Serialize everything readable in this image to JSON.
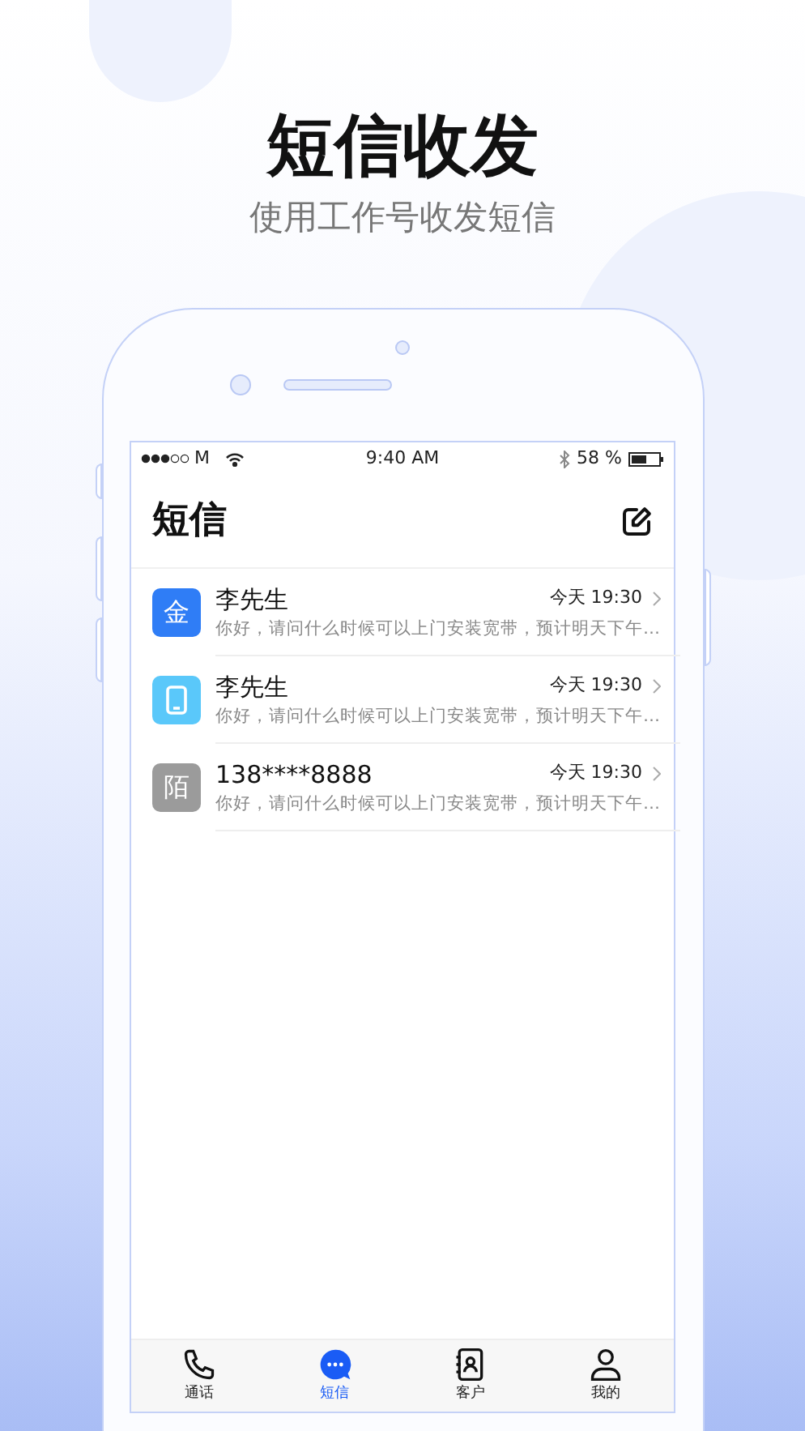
{
  "headline": {
    "title": "短信收发",
    "subtitle": "使用工作号收发短信"
  },
  "status_bar": {
    "carrier": "M",
    "time": "9:40 AM",
    "battery": "58 %"
  },
  "screen_title": "短信",
  "messages": [
    {
      "avatar": {
        "kind": "text",
        "text": "金",
        "color": "#2f7df6"
      },
      "name": "李先生",
      "time": "今天 19:30",
      "preview": "你好，请问什么时候可以上门安装宽带，预计明天下午…"
    },
    {
      "avatar": {
        "kind": "phone",
        "color": "#5ac8fa"
      },
      "name": "李先生",
      "time": "今天 19:30",
      "preview": "你好，请问什么时候可以上门安装宽带，预计明天下午…"
    },
    {
      "avatar": {
        "kind": "text",
        "text": "陌",
        "color": "#9b9b9b"
      },
      "name": "138****8888",
      "time": "今天 19:30",
      "preview": "你好，请问什么时候可以上门安装宽带，预计明天下午…"
    }
  ],
  "tabs": [
    {
      "kind": "phone",
      "label": "通话",
      "selected": false
    },
    {
      "kind": "chat",
      "label": "短信",
      "selected": true
    },
    {
      "kind": "contacts",
      "label": "客户",
      "selected": false
    },
    {
      "kind": "person",
      "label": "我的",
      "selected": false
    }
  ]
}
